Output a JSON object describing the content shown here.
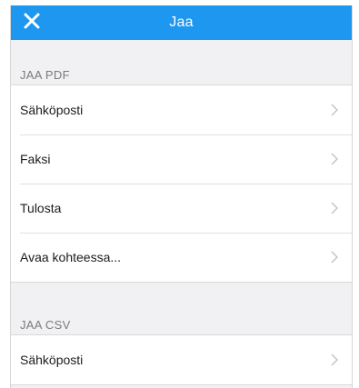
{
  "navbar": {
    "title": "Jaa",
    "close_icon": "close-icon",
    "background": "#1d97ef"
  },
  "sections": [
    {
      "header": "JAA PDF",
      "items": [
        {
          "label": "Sähköposti",
          "icon": "chevron-right-icon"
        },
        {
          "label": "Faksi",
          "icon": "chevron-right-icon"
        },
        {
          "label": "Tulosta",
          "icon": "chevron-right-icon"
        },
        {
          "label": "Avaa kohteessa...",
          "icon": "chevron-right-icon"
        }
      ]
    },
    {
      "header": "JAA CSV",
      "items": [
        {
          "label": "Sähköposti",
          "icon": "chevron-right-icon"
        }
      ]
    }
  ]
}
